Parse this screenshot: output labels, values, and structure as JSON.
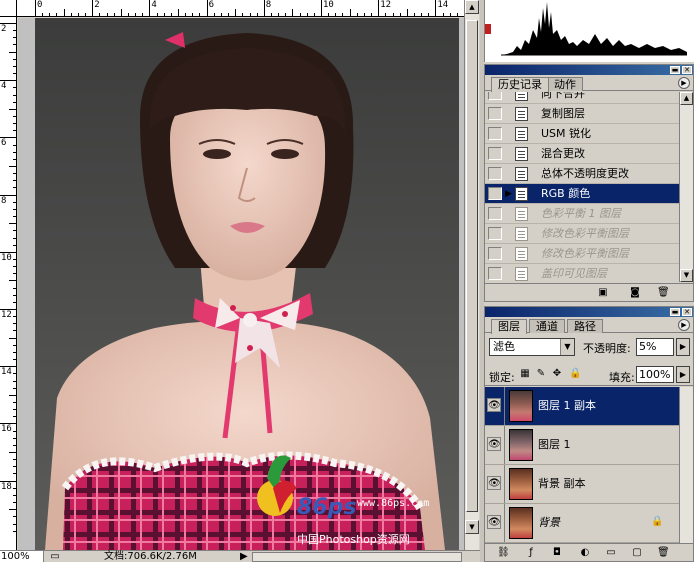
{
  "ruler": {
    "top_labels": [
      "0",
      "2",
      "4",
      "6",
      "8",
      "10",
      "12",
      "14"
    ],
    "left_labels": [
      "2",
      "4",
      "6",
      "8",
      "10",
      "12",
      "14",
      "16",
      "18"
    ]
  },
  "document": {
    "watermark_site": "www.86ps.com",
    "watermark_logo_text": "86ps",
    "watermark_cn": "中国Photoshop资源网"
  },
  "status": {
    "zoom": "100%",
    "doc_info": "文档:706.6K/2.76M",
    "arrow": "▶"
  },
  "history_panel": {
    "tabs": [
      "历史记录",
      "动作"
    ],
    "items": [
      {
        "label": "向下合并",
        "state": "normal"
      },
      {
        "label": "复制图层",
        "state": "normal"
      },
      {
        "label": "USM 锐化",
        "state": "normal"
      },
      {
        "label": "混合更改",
        "state": "normal"
      },
      {
        "label": "总体不透明度更改",
        "state": "normal"
      },
      {
        "label": "RGB 颜色",
        "state": "selected"
      },
      {
        "label": "色彩平衡 1 图层",
        "state": "dimmed"
      },
      {
        "label": "修改色彩平衡图层",
        "state": "dimmed"
      },
      {
        "label": "修改色彩平衡图层",
        "state": "dimmed"
      },
      {
        "label": "盖印可见图层",
        "state": "dimmed"
      }
    ]
  },
  "layers_panel": {
    "tabs": [
      "图层",
      "通道",
      "路径"
    ],
    "blend_mode": "滤色",
    "opacity_label": "不透明度:",
    "opacity_value": "5%",
    "lock_label": "锁定:",
    "fill_label": "填充:",
    "fill_value": "100%",
    "layers": [
      {
        "name": "图层 1 副本",
        "selected": true,
        "italic": false,
        "locked": false
      },
      {
        "name": "图层 1",
        "selected": false,
        "italic": false,
        "locked": false
      },
      {
        "name": "背景 副本",
        "selected": false,
        "italic": false,
        "locked": false
      },
      {
        "name": "背景",
        "selected": false,
        "italic": true,
        "locked": true
      }
    ]
  },
  "colors": {
    "selection": "#0a246a",
    "panel_bg": "#d4d0c8",
    "collar": "#e23a6e"
  },
  "icons": [
    "eye-icon",
    "brush-icon",
    "lock-icon",
    "trash-icon",
    "new-layer-icon",
    "snapshot-icon",
    "link-icon",
    "fx-icon",
    "mask-icon",
    "adjustment-icon",
    "folder-icon",
    "panel-menu-icon"
  ]
}
